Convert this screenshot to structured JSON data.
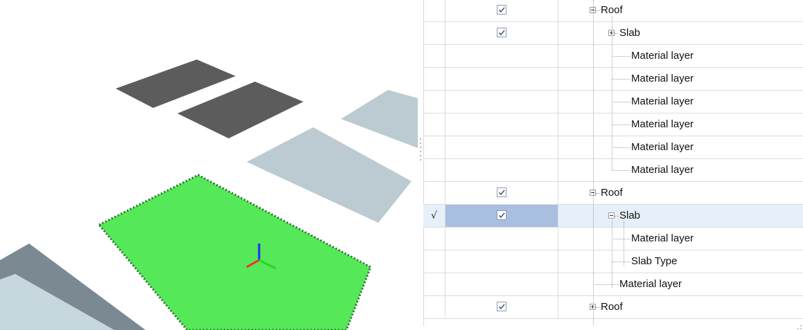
{
  "viewport": {
    "colors": {
      "background": "#ffffff",
      "dark_slab": "#5c5c5c",
      "light_slab": "#bccbd1",
      "selected_slab": "#55e859",
      "selection_outline": "#2d6b2d",
      "roof_dark": "#7b8a92",
      "roof_light": "#c6d7dd",
      "axis_x": "#ff2a2a",
      "axis_y": "#22d822",
      "axis_z": "#1a2cff"
    }
  },
  "tree": {
    "colors": {
      "selected_row": "#e5f0fb",
      "selected_check_cell": "#a8bfe0",
      "grid_line": "#dcdcdc"
    },
    "rows": [
      {
        "indicator": "",
        "checked": true,
        "expander": "minus",
        "label": "Roof"
      },
      {
        "indicator": "",
        "checked": true,
        "expander": "plus",
        "label": "Slab"
      },
      {
        "indicator": "",
        "checked": false,
        "expander": "",
        "label": "Material layer"
      },
      {
        "indicator": "",
        "checked": false,
        "expander": "",
        "label": "Material layer"
      },
      {
        "indicator": "",
        "checked": false,
        "expander": "",
        "label": "Material layer"
      },
      {
        "indicator": "",
        "checked": false,
        "expander": "",
        "label": "Material layer"
      },
      {
        "indicator": "",
        "checked": false,
        "expander": "",
        "label": "Material layer"
      },
      {
        "indicator": "",
        "checked": false,
        "expander": "",
        "label": "Material layer"
      },
      {
        "indicator": "",
        "checked": true,
        "expander": "minus",
        "label": "Roof"
      },
      {
        "indicator": "√",
        "checked": true,
        "expander": "minus",
        "label": "Slab",
        "selected": true
      },
      {
        "indicator": "",
        "checked": false,
        "expander": "",
        "label": "Material layer"
      },
      {
        "indicator": "",
        "checked": false,
        "expander": "",
        "label": "Slab Type"
      },
      {
        "indicator": "",
        "checked": false,
        "expander": "",
        "label": "Material layer"
      },
      {
        "indicator": "",
        "checked": true,
        "expander": "plus",
        "label": "Roof"
      }
    ]
  }
}
